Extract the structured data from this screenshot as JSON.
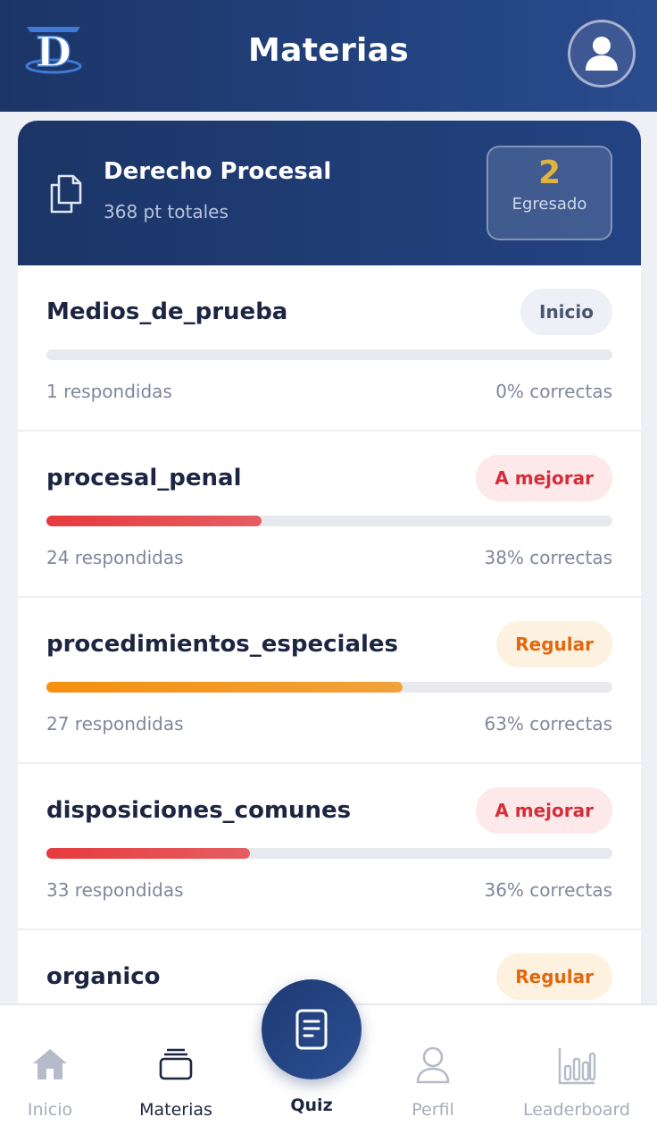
{
  "header": {
    "title": "Materias",
    "logo_icon": "logo-d-icon",
    "avatar_icon": "user-icon"
  },
  "subject": {
    "name": "Derecho Procesal",
    "points": "368 pt totales",
    "icon": "documents-icon",
    "level": {
      "value": "2",
      "label": "Egresado"
    }
  },
  "topics": [
    {
      "name": "Medios_de_prueba",
      "badge": "Inicio",
      "progress": 0,
      "answered": "1 respondidas",
      "correct": "0% correctas"
    },
    {
      "name": "procesal_penal",
      "badge": "A mejorar",
      "progress": 0.38,
      "answered": "24 respondidas",
      "correct": "38% correctas"
    },
    {
      "name": "procedimientos_especiales",
      "badge": "Regular",
      "progress": 0.63,
      "answered": "27 respondidas",
      "correct": "63% correctas"
    },
    {
      "name": "disposiciones_comunes",
      "badge": "A mejorar",
      "progress": 0.36,
      "answered": "33 respondidas",
      "correct": "36% correctas"
    },
    {
      "name": "organico",
      "badge": "Regular"
    }
  ],
  "colors": {
    "primary": "#1c3566",
    "level_gold": "#e0b341",
    "badge_inicio_bg": "#eef0f7",
    "badge_inicio_text": "#4a5470",
    "badge_mejorar_bg": "#fde8ea",
    "badge_mejorar_text": "#d32f3a",
    "badge_regular_bg": "#fdf1df",
    "badge_regular_text": "#e0680e",
    "bar_red": "#e63b3e",
    "bar_orange": "#f5900f"
  },
  "tabbar": {
    "items": [
      {
        "label": "Inicio",
        "icon": "home-icon",
        "active": false
      },
      {
        "label": "Materias",
        "icon": "stack-icon",
        "active": true
      },
      {
        "label": "Quiz",
        "icon": "quiz-document-icon",
        "active": false
      },
      {
        "label": "Perfil",
        "icon": "person-icon",
        "active": false
      },
      {
        "label": "Leaderboard",
        "icon": "bar-chart-icon",
        "active": false
      }
    ]
  }
}
